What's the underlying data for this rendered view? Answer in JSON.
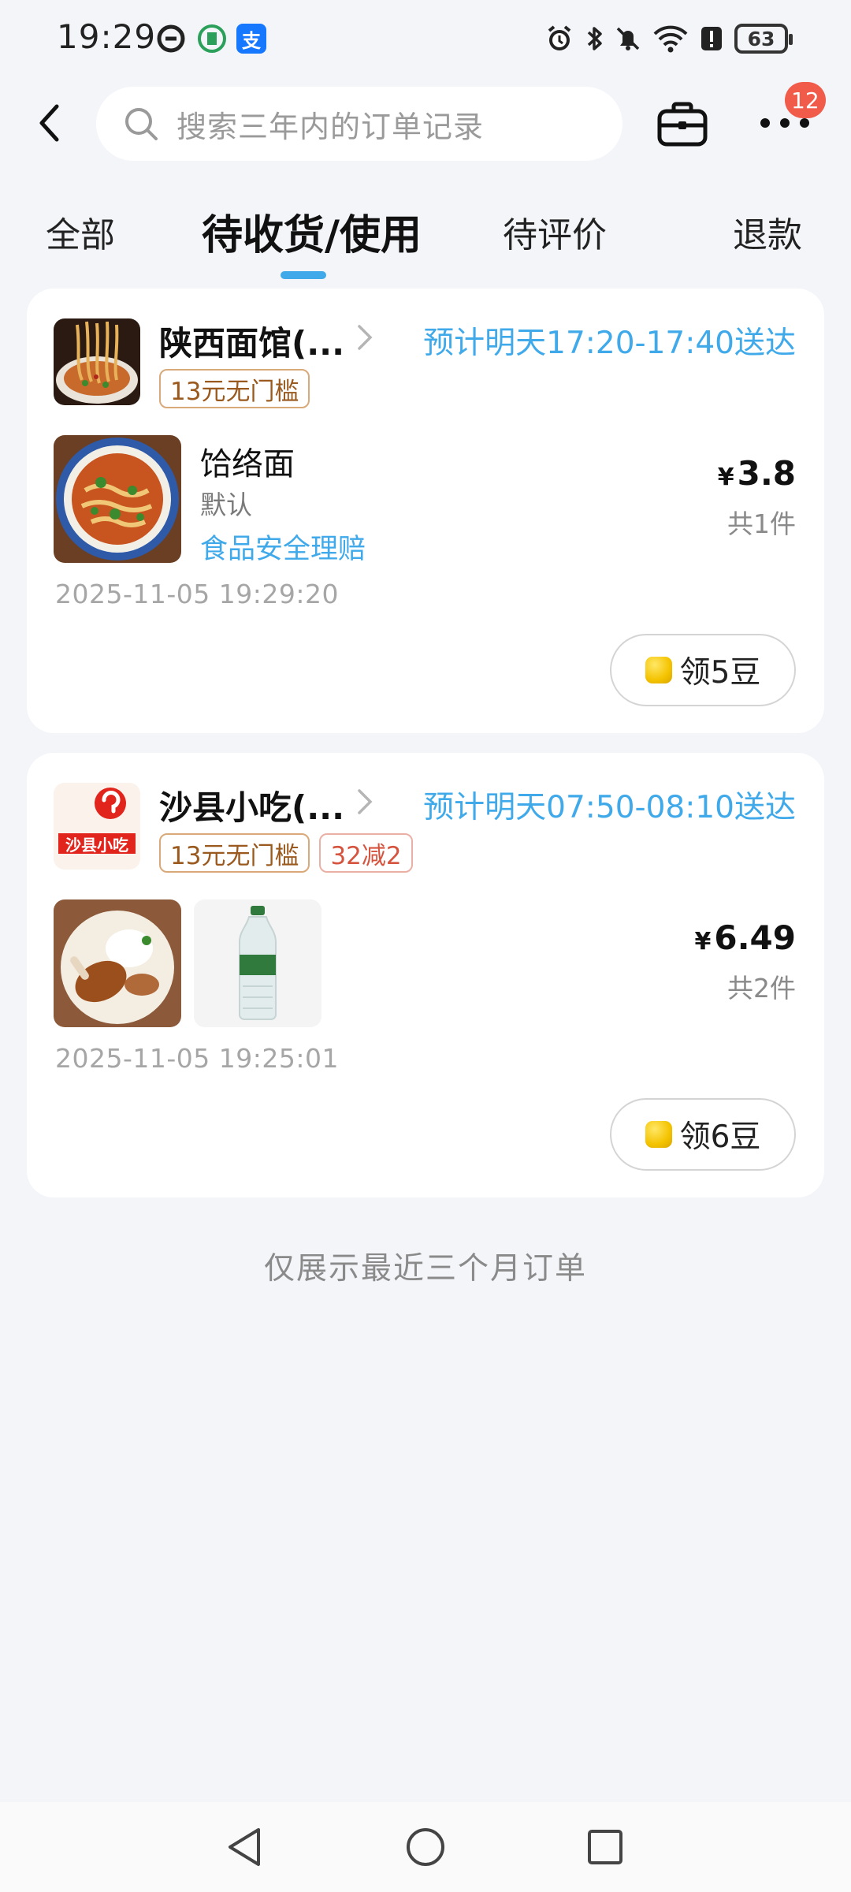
{
  "status_bar": {
    "time": "19:29",
    "app_icons": [
      "c-app-icon",
      "green-app-icon",
      "alipay-icon"
    ],
    "alipay_glyph": "支",
    "battery": "63"
  },
  "header": {
    "search_placeholder": "搜索三年内的订单记录",
    "more_badge": "12"
  },
  "tabs": [
    {
      "label": "全部",
      "active": false
    },
    {
      "label": "待收货/使用",
      "active": true
    },
    {
      "label": "待评价",
      "active": false
    },
    {
      "label": "退款",
      "active": false
    }
  ],
  "orders": [
    {
      "shop_name": "陕西面馆(...",
      "eta": "预计明天17:20-17:40送达",
      "tags": [
        "13元无门槛"
      ],
      "item_name": "饸络面",
      "item_spec": "默认",
      "item_link": "食品安全理赔",
      "price_symbol": "¥",
      "price": "3.8",
      "count": "共1件",
      "order_time": "2025-11-05 19:29:20",
      "bean_label": "领5豆"
    },
    {
      "shop_name": "沙县小吃(...",
      "eta": "预计明天07:50-08:10送达",
      "tags": [
        "13元无门槛",
        "32减2"
      ],
      "price_symbol": "¥",
      "price": "6.49",
      "count": "共2件",
      "order_time": "2025-11-05 19:25:01",
      "bean_label": "领6豆",
      "logo_text": "沙县小吃"
    }
  ],
  "footer_note": "仅展示最近三个月订单",
  "colors": {
    "accent": "#3fa9ea",
    "badge": "#f05b4a",
    "background": "#f3f5f9"
  }
}
